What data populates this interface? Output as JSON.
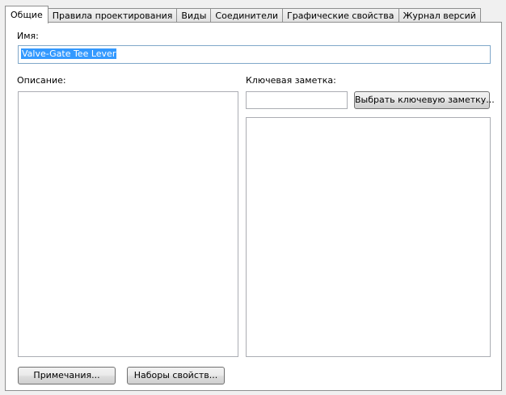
{
  "tabs": [
    {
      "label": "Общие",
      "active": true
    },
    {
      "label": "Правила проектирования",
      "active": false
    },
    {
      "label": "Виды",
      "active": false
    },
    {
      "label": "Соединители",
      "active": false
    },
    {
      "label": "Графические свойства",
      "active": false
    },
    {
      "label": "Журнал версий",
      "active": false
    }
  ],
  "general": {
    "name_label": "Имя:",
    "name_value": "Valve-Gate Tee Lever",
    "description_label": "Описание:",
    "keynote_label": "Ключевая заметка:",
    "keynote_value": "",
    "select_keynote_button": "Выбрать ключевую заметку...",
    "notes_button": "Примечания...",
    "property_sets_button": "Наборы свойств..."
  },
  "colors": {
    "selection": "#3399ff",
    "focus_border": "#7fa7c9"
  }
}
